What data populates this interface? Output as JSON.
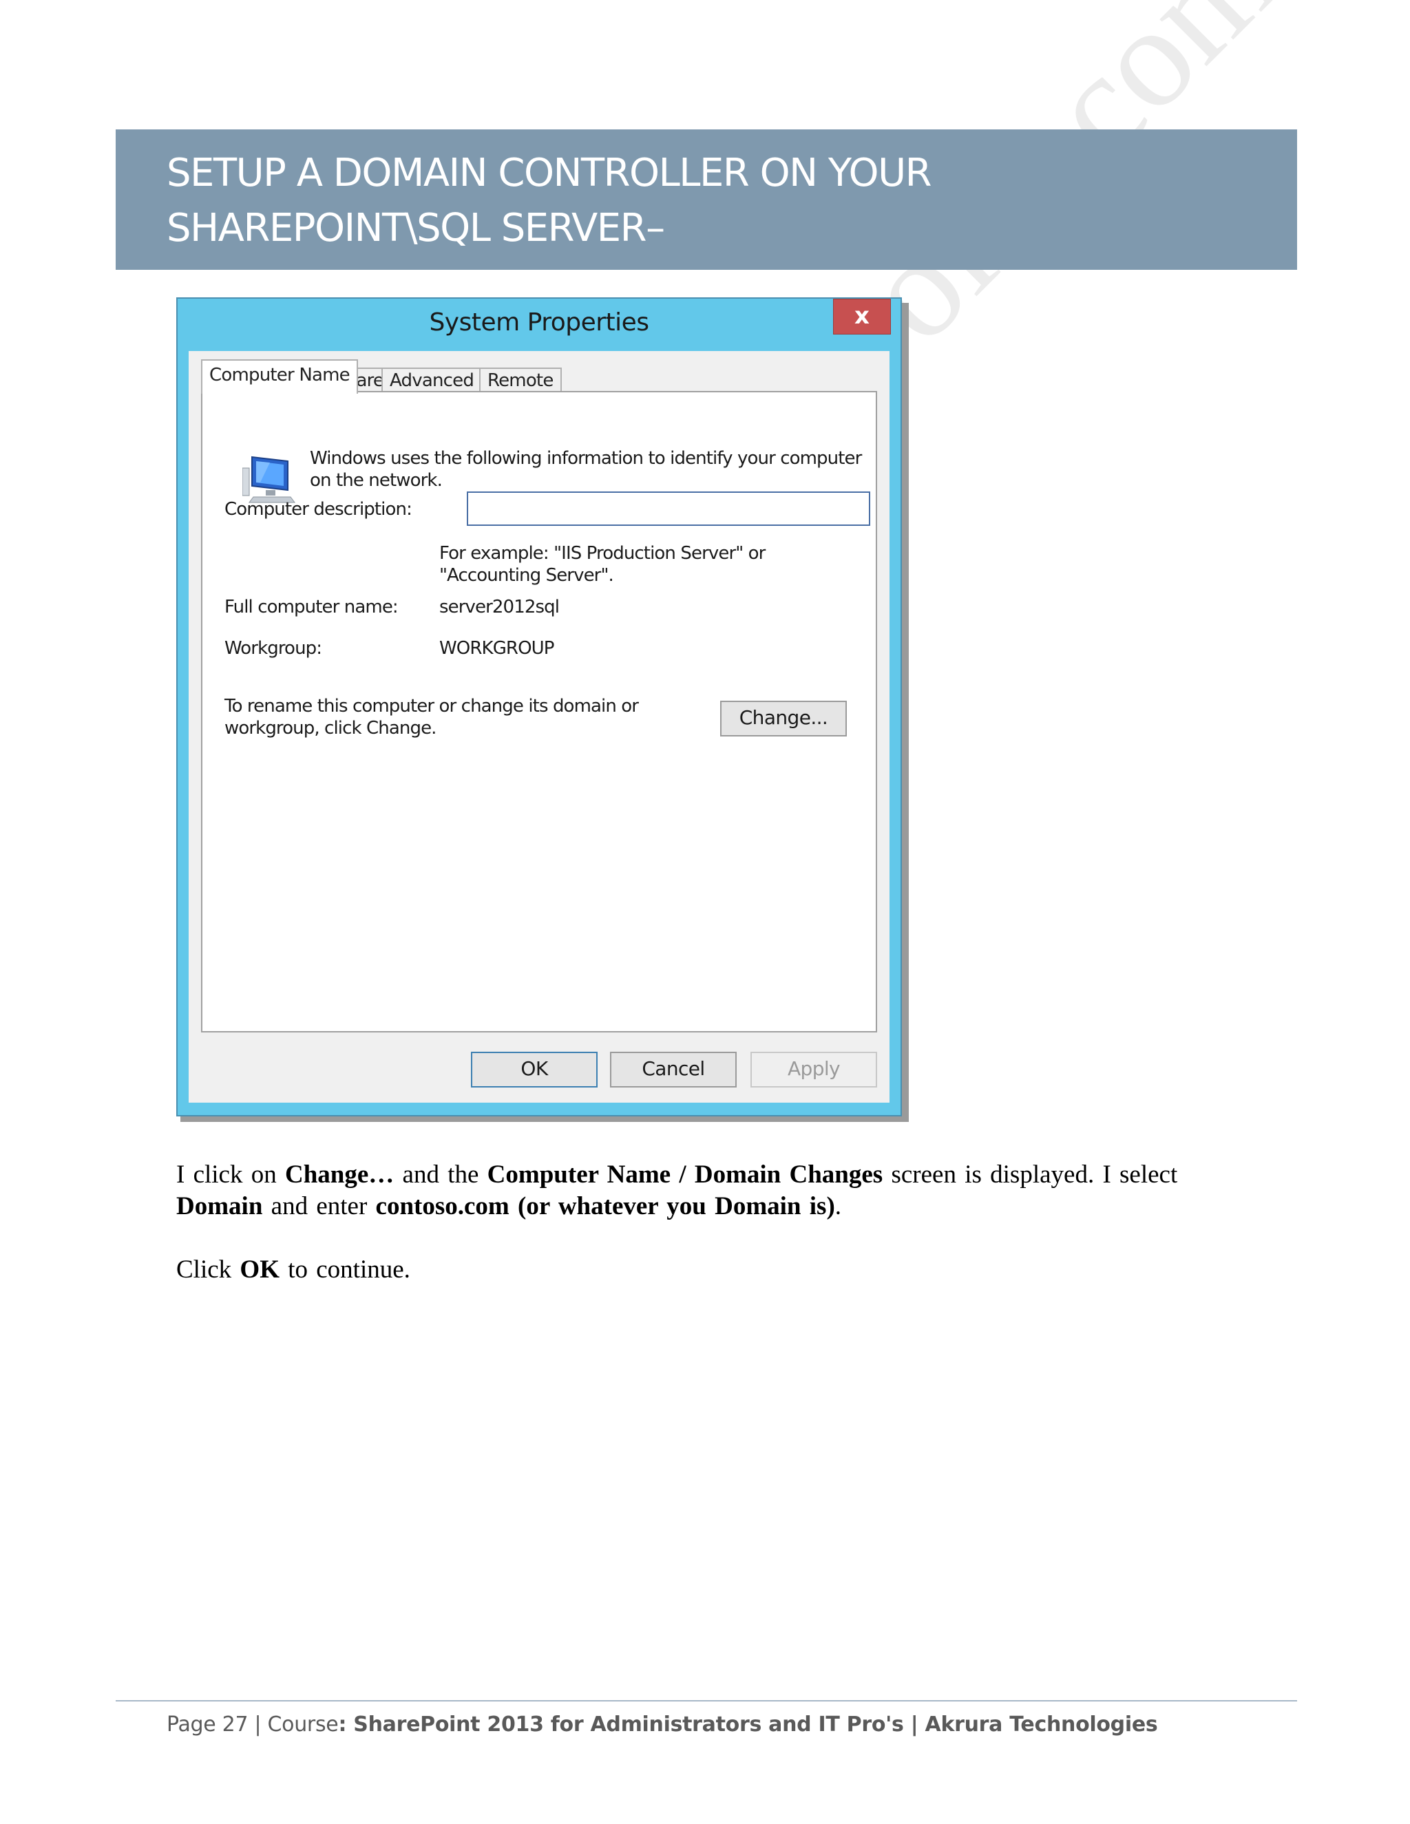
{
  "header": {
    "title_line1": "SETUP A DOMAIN CONTROLLER ON YOUR",
    "title_line2": "SHAREPOINT\\SQL SERVER–"
  },
  "watermark": "LearningSharePoint.com",
  "dialog": {
    "title": "System Properties",
    "close_label": "x",
    "tabs": [
      "Computer Name",
      "Hardware",
      "Advanced",
      "Remote"
    ],
    "active_tab": "Computer Name",
    "icon": "computer-monitor-icon",
    "intro_line1": "Windows uses the following information to identify your computer",
    "intro_line2": "on the network.",
    "description_label": "Computer description:",
    "description_value": "",
    "example_line1": "For example: \"IIS Production Server\" or",
    "example_line2": "\"Accounting Server\".",
    "full_name_label": "Full computer name:",
    "full_name_value": "server2012sql",
    "workgroup_label": "Workgroup:",
    "workgroup_value": "WORKGROUP",
    "rename_line1": "To rename this computer or change its domain or",
    "rename_line2": "workgroup, click Change.",
    "change_button": "Change...",
    "ok_button": "OK",
    "cancel_button": "Cancel",
    "apply_button": "Apply"
  },
  "body": {
    "p1_a": "I click  on ",
    "p1_b": "Change…",
    "p1_c": " and the ",
    "p1_d": "Computer  Name / Domain  Changes",
    "p1_e": " screen is displayed.  I select ",
    "p1_f": "Domain",
    "p1_g": " and enter ",
    "p1_h": "contoso.com (or whatever you Domain is)",
    "p1_i": ".",
    "p2_a": "Click  ",
    "p2_b": "OK",
    "p2_c": " to continue."
  },
  "footer": {
    "page_prefix": "Page  27 | Course",
    "course": ": SharePoint 2013 for Administrators and IT Pro's | Akrura Technologies"
  }
}
